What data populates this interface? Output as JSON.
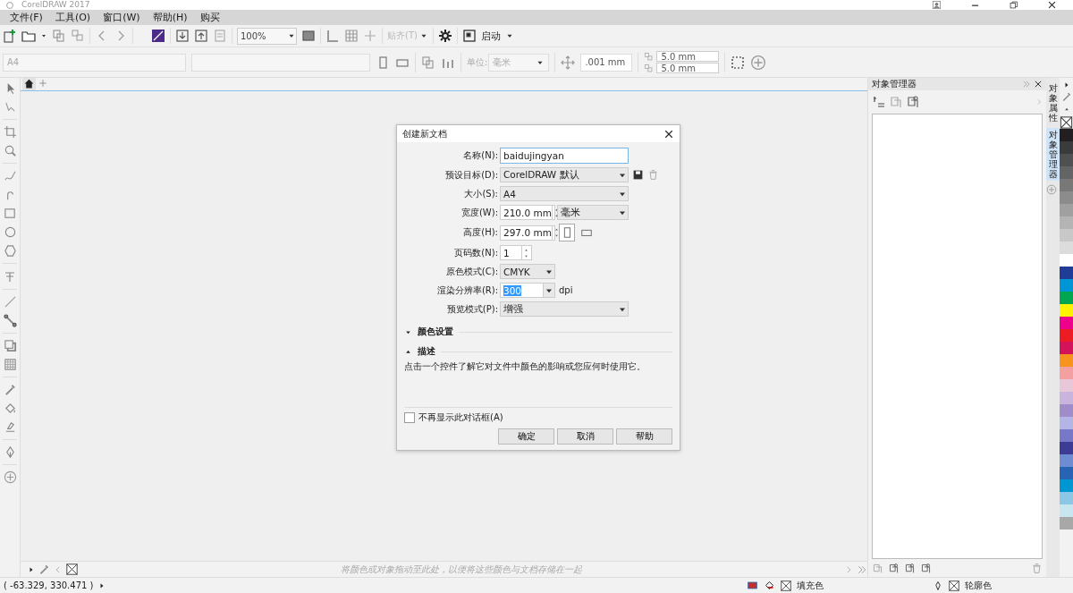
{
  "window": {
    "title": "CorelDRAW 2017"
  },
  "menu": [
    {
      "label": "文件(F)"
    },
    {
      "label": "工具(O)"
    },
    {
      "label": "窗口(W)"
    },
    {
      "label": "帮助(H)"
    },
    {
      "label": "购买"
    }
  ],
  "toolbar": {
    "zoom": "100%",
    "snap": "贴齐(T)",
    "launch": "启动"
  },
  "property_bar": {
    "page_size": "A4",
    "units_label": "单位:",
    "units": "毫米",
    "nudge": ".001 mm",
    "duplicate_x": "5.0 mm",
    "duplicate_y": "5.0 mm"
  },
  "dialog": {
    "title": "创建新文档",
    "fields": [
      {
        "kind": "text",
        "label": "名称(N):",
        "value": "baidujingyan",
        "focused": true
      },
      {
        "kind": "preset",
        "label": "预设目标(D):",
        "value": "CorelDRAW 默认"
      },
      {
        "kind": "select",
        "label": "大小(S):",
        "value": "A4"
      },
      {
        "kind": "spin_unit",
        "label": "宽度(W):",
        "value": "210.0 mm",
        "unit": "毫米"
      },
      {
        "kind": "spin_orientation",
        "label": "高度(H):",
        "value": "297.0 mm",
        "portrait_selected": true
      },
      {
        "kind": "spin",
        "label": "页码数(N):",
        "value": "1"
      },
      {
        "kind": "select_small",
        "label": "原色模式(C):",
        "value": "CMYK"
      },
      {
        "kind": "combo_suffix",
        "label": "渲染分辨率(R):",
        "value": "300",
        "value_selected": true,
        "suffix": "dpi"
      },
      {
        "kind": "select",
        "label": "预览模式(P):",
        "value": "增强"
      }
    ],
    "sections": [
      {
        "label": "颜色设置",
        "expanded": false
      },
      {
        "label": "描述",
        "expanded": true
      }
    ],
    "description": "点击一个控件了解它对文件中颜色的影响或您应何时使用它。",
    "dont_show": {
      "label": "不再显示此对话框(A)",
      "checked": false
    },
    "buttons": [
      "确定",
      "取消",
      "帮助"
    ]
  },
  "docker": {
    "title": "对象管理器",
    "side_tabs": [
      {
        "label": "对象属性",
        "selected": false
      },
      {
        "label": "对象管理器",
        "selected": true
      }
    ]
  },
  "palette": [
    {
      "color": "#231f20"
    },
    {
      "color": "#3b3b3b"
    },
    {
      "color": "#505050"
    },
    {
      "color": "#646464"
    },
    {
      "color": "#787878"
    },
    {
      "color": "#8c8c8c"
    },
    {
      "color": "#a0a0a0"
    },
    {
      "color": "#b4b4b4"
    },
    {
      "color": "#c8c8c8"
    },
    {
      "color": "#dcdcdc"
    },
    {
      "color": "#ffffff"
    },
    {
      "color": "#1f3c96"
    },
    {
      "color": "#0096d6"
    },
    {
      "color": "#00a650"
    },
    {
      "color": "#fff200"
    },
    {
      "color": "#ec008c"
    },
    {
      "color": "#ed1c24"
    },
    {
      "color": "#d4145a"
    },
    {
      "color": "#f7941d"
    },
    {
      "color": "#f4a0a0"
    },
    {
      "color": "#e8c8d8"
    },
    {
      "color": "#c8b4dc"
    },
    {
      "color": "#a08cc8"
    },
    {
      "color": "#b4b4e6"
    },
    {
      "color": "#7878c8"
    },
    {
      "color": "#3c3c96"
    },
    {
      "color": "#6e8cd2"
    },
    {
      "color": "#2864b4"
    },
    {
      "color": "#0096d2"
    },
    {
      "color": "#8cc8e6"
    },
    {
      "color": "#c8e6f0"
    },
    {
      "color": "#a8a8a8"
    }
  ],
  "color_bar": {
    "hint": "将颜色或对象拖动至此处，以便将这些颜色与文档存储在一起"
  },
  "status_bar": {
    "coordinates": "( -63.329, 330.471 )",
    "fill_label": "填充色",
    "outline_label": "轮廓色"
  }
}
